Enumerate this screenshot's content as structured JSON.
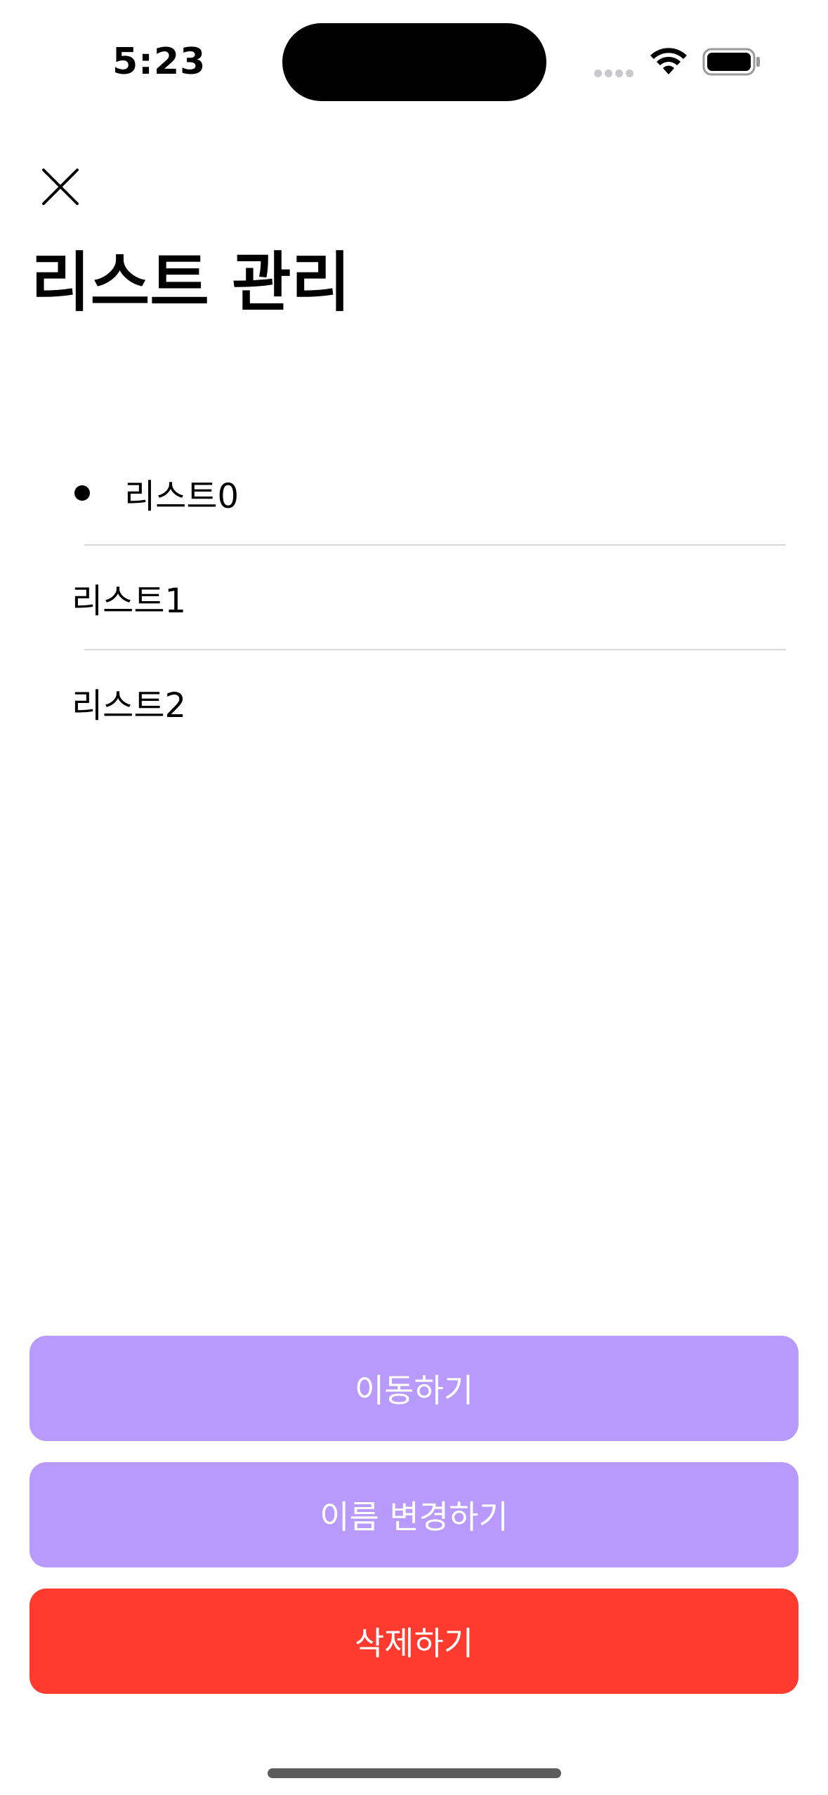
{
  "status_bar": {
    "time": "5:23"
  },
  "nav": {
    "close_icon": "close-icon"
  },
  "header": {
    "title": "리스트 관리"
  },
  "list": {
    "items": [
      {
        "label": "리스트0",
        "selected": true
      },
      {
        "label": "리스트1",
        "selected": false
      },
      {
        "label": "리스트2",
        "selected": false
      }
    ]
  },
  "actions": {
    "move_label": "이동하기",
    "rename_label": "이름 변경하기",
    "delete_label": "삭제하기"
  },
  "colors": {
    "primary_button": "#b89afc",
    "danger_button": "#ff3b30",
    "button_text": "#ffffff",
    "divider": "#d8d8d8"
  }
}
